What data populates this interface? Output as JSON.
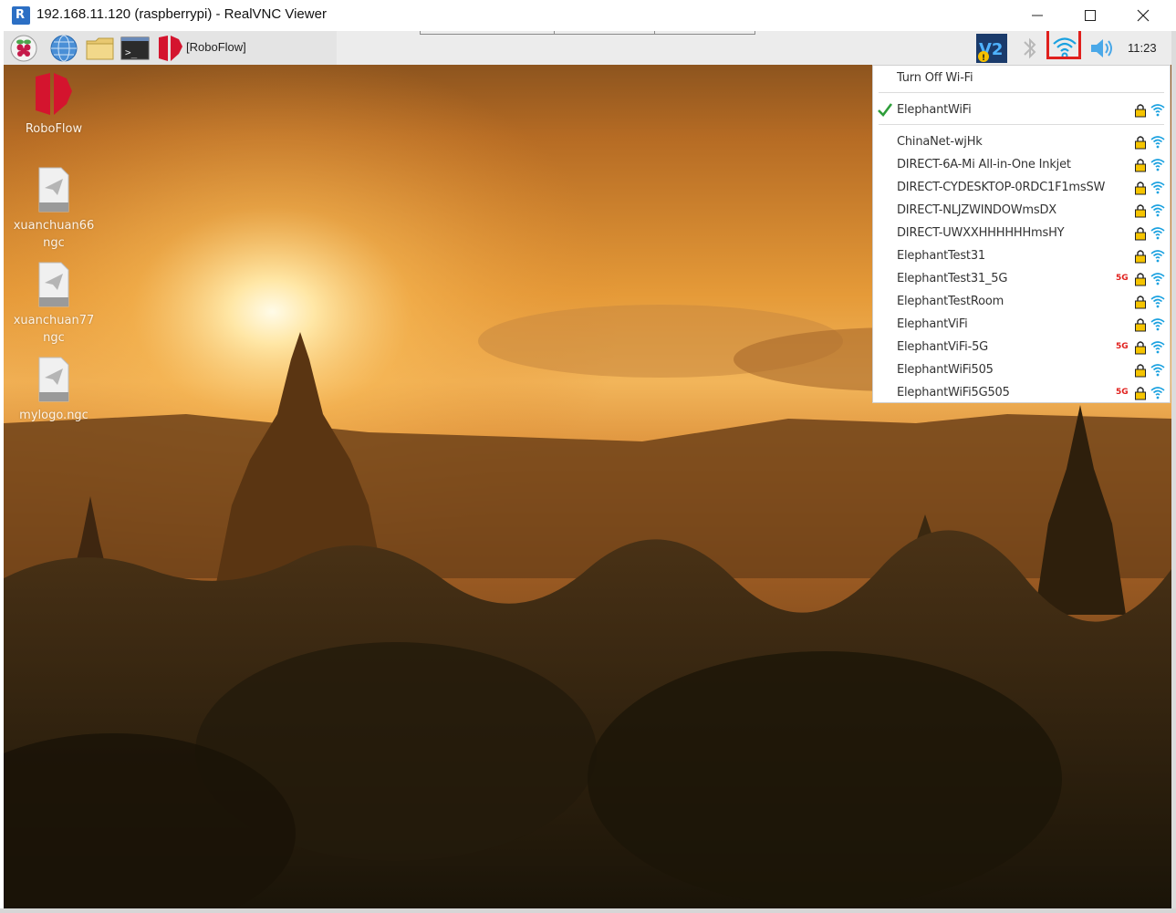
{
  "window": {
    "title": "192.168.11.120 (raspberrypi) - RealVNC Viewer",
    "app_icon_glyph": "R"
  },
  "taskbar": {
    "app_label": "[RoboFlow]",
    "clock": "11:23",
    "icons": [
      "raspberry-menu-icon",
      "browser-globe-icon",
      "file-manager-icon",
      "terminal-icon",
      "roboflow-icon"
    ],
    "tray_icons": [
      "vnc-icon",
      "bluetooth-icon",
      "wifi-icon",
      "volume-icon"
    ]
  },
  "desktop": {
    "items": [
      {
        "label": "RoboFlow",
        "icon": "roboflow-logo-icon"
      },
      {
        "label": "xuanchuan66\nngc",
        "icon": "file-icon"
      },
      {
        "label": "xuanchuan77\nngc",
        "icon": "file-icon"
      },
      {
        "label": "mylogo.ngc",
        "icon": "file-icon"
      }
    ]
  },
  "wifi_menu": {
    "toggle_label": "Turn Off Wi-Fi",
    "connected": {
      "ssid": "ElephantWiFi",
      "secured": true,
      "five_g": false
    },
    "networks": [
      {
        "ssid": "ChinaNet-wjHk",
        "secured": true,
        "five_g": false,
        "five_g_label": ""
      },
      {
        "ssid": "DIRECT-6A-Mi All-in-One Inkjet",
        "secured": true,
        "five_g": false,
        "five_g_label": ""
      },
      {
        "ssid": "DIRECT-CYDESKTOP-0RDC1F1msSW",
        "secured": true,
        "five_g": false,
        "five_g_label": ""
      },
      {
        "ssid": "DIRECT-NLJZWINDOWmsDX",
        "secured": true,
        "five_g": false,
        "five_g_label": ""
      },
      {
        "ssid": "DIRECT-UWXXHHHHHHmsHY",
        "secured": true,
        "five_g": false,
        "five_g_label": ""
      },
      {
        "ssid": "ElephantTest31",
        "secured": true,
        "five_g": false,
        "five_g_label": ""
      },
      {
        "ssid": "ElephantTest31_5G",
        "secured": true,
        "five_g": true,
        "five_g_label": "5G"
      },
      {
        "ssid": "ElephantTestRoom",
        "secured": true,
        "five_g": false,
        "five_g_label": ""
      },
      {
        "ssid": "ElephantViFi",
        "secured": true,
        "five_g": false,
        "five_g_label": ""
      },
      {
        "ssid": "ElephantViFi-5G",
        "secured": true,
        "five_g": true,
        "five_g_label": "5G"
      },
      {
        "ssid": "ElephantWiFi505",
        "secured": true,
        "five_g": false,
        "five_g_label": ""
      },
      {
        "ssid": "ElephantWiFi5G505",
        "secured": true,
        "five_g": true,
        "five_g_label": "5G"
      }
    ]
  },
  "colors": {
    "highlight": "#e0201d",
    "wifi_blue": "#1aa1e0",
    "check_green": "#2e9e3a",
    "roboflow_red": "#d4142e"
  }
}
